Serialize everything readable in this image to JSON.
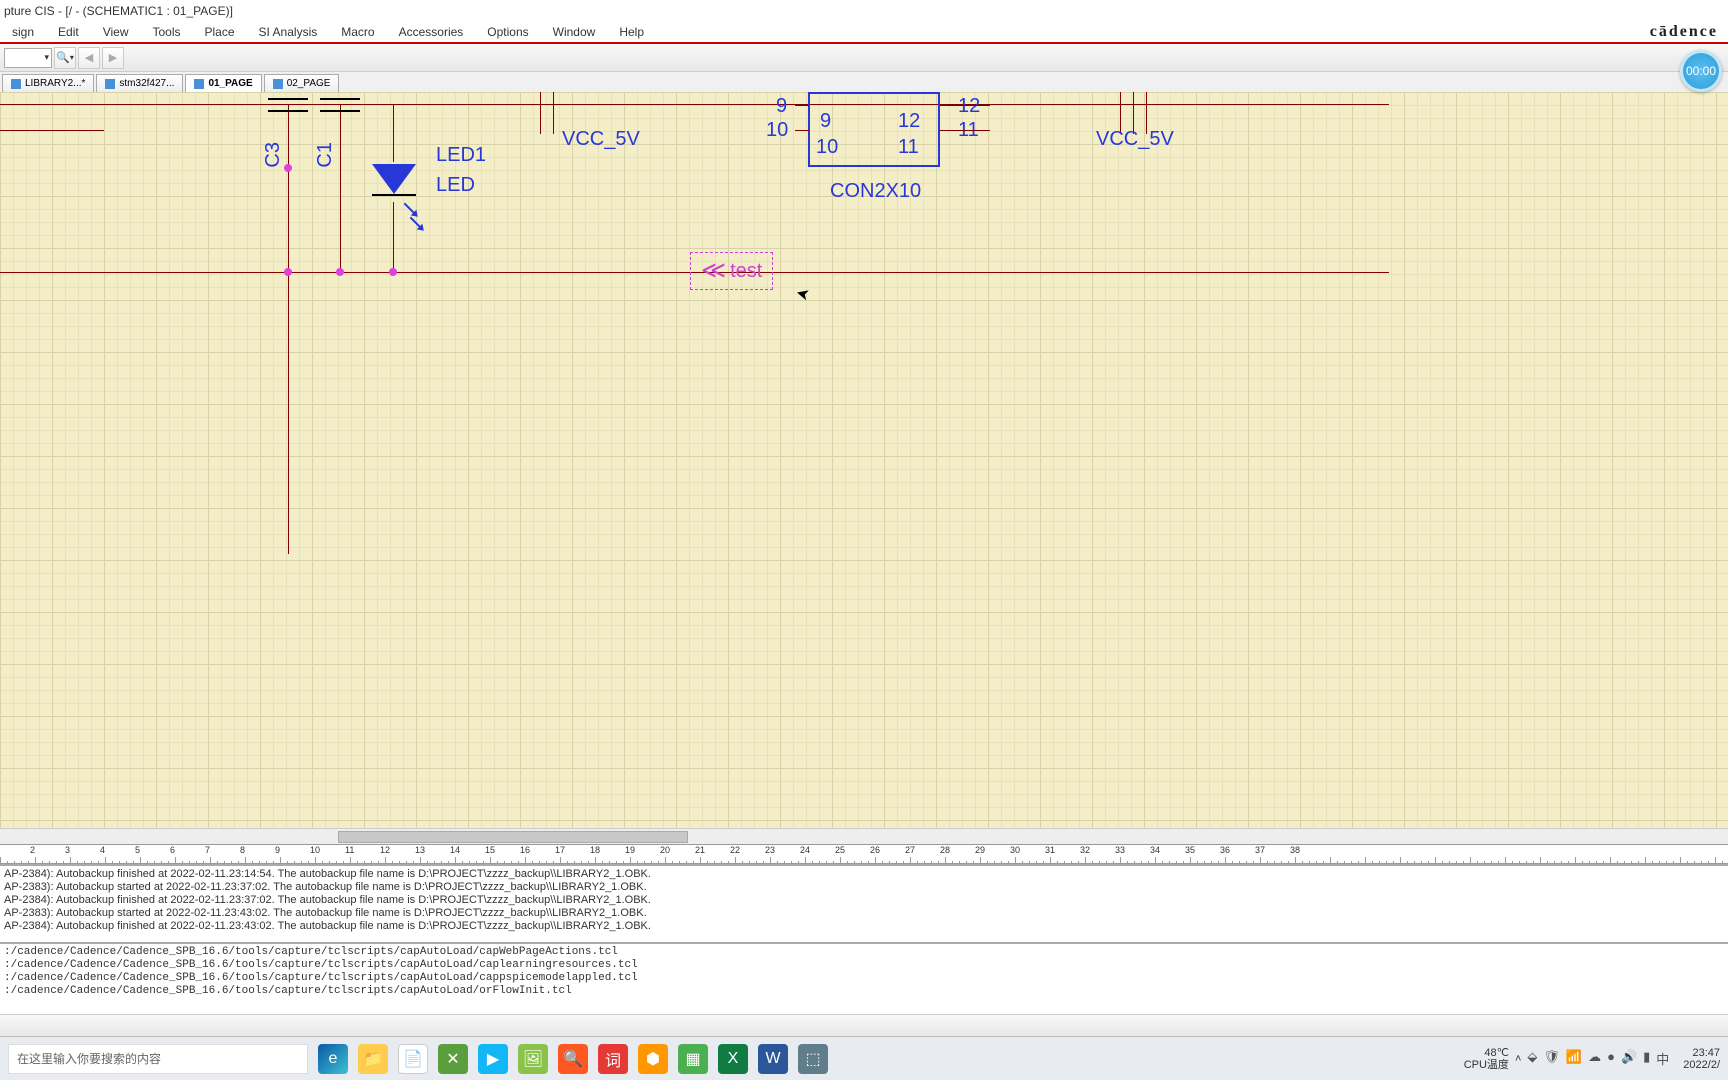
{
  "titlebar": "pture CIS - [/ - (SCHEMATIC1 : 01_PAGE)]",
  "menu": [
    "sign",
    "Edit",
    "View",
    "Tools",
    "Place",
    "SI Analysis",
    "Macro",
    "Accessories",
    "Options",
    "Window",
    "Help"
  ],
  "brand": "cādence",
  "timer": "00:00",
  "tabs": [
    {
      "label": "LIBRARY2...*",
      "active": false
    },
    {
      "label": "stm32f427...",
      "active": false
    },
    {
      "label": "01_PAGE",
      "active": true
    },
    {
      "label": "02_PAGE",
      "active": false
    }
  ],
  "schematic": {
    "refdes_c3": "C3",
    "refdes_c1": "C1",
    "led_ref": "LED1",
    "led_val": "LED",
    "vcc_left": "VCC_5V",
    "vcc_right": "VCC_5V",
    "conn_label": "CON2X10",
    "pins_left": [
      "9",
      "10"
    ],
    "pins_mid_l": [
      "9",
      "10"
    ],
    "pins_mid_r": [
      "12",
      "11"
    ],
    "pins_right": [
      "12",
      "11"
    ],
    "offpage": "test"
  },
  "ruler_numbers": [
    "2",
    "3",
    "4",
    "5",
    "6",
    "7",
    "8",
    "9",
    "10",
    "11",
    "12",
    "13",
    "14",
    "15",
    "16",
    "17",
    "18",
    "19",
    "20",
    "21",
    "22",
    "23",
    "24",
    "25",
    "26",
    "27",
    "28",
    "29",
    "30",
    "31",
    "32",
    "33",
    "34",
    "35",
    "36",
    "37",
    "38"
  ],
  "log": [
    "AP-2384): Autobackup finished at 2022-02-11.23:14:54. The autobackup file name is D:\\PROJECT\\zzzz_backup\\\\LIBRARY2_1.OBK.",
    "AP-2383): Autobackup started at 2022-02-11.23:37:02. The autobackup file name is D:\\PROJECT\\zzzz_backup\\\\LIBRARY2_1.OBK.",
    "AP-2384): Autobackup finished at 2022-02-11.23:37:02. The autobackup file name is D:\\PROJECT\\zzzz_backup\\\\LIBRARY2_1.OBK.",
    "AP-2383): Autobackup started at 2022-02-11.23:43:02. The autobackup file name is D:\\PROJECT\\zzzz_backup\\\\LIBRARY2_1.OBK.",
    "AP-2384): Autobackup finished at 2022-02-11.23:43:02. The autobackup file name is D:\\PROJECT\\zzzz_backup\\\\LIBRARY2_1.OBK."
  ],
  "tcl": [
    ":/cadence/Cadence/Cadence_SPB_16.6/tools/capture/tclscripts/capAutoLoad/capWebPageActions.tcl",
    ":/cadence/Cadence/Cadence_SPB_16.6/tools/capture/tclscripts/capAutoLoad/caplearningresources.tcl",
    ":/cadence/Cadence/Cadence_SPB_16.6/tools/capture/tclscripts/capAutoLoad/cappspicemodelappled.tcl",
    ":/cadence/Cadence/Cadence_SPB_16.6/tools/capture/tclscripts/capAutoLoad/orFlowInit.tcl"
  ],
  "taskbar": {
    "search_placeholder": "在这里输入你要搜索的内容",
    "temp": "48℃",
    "temp_label": "CPU温度",
    "time": "23:47",
    "date": "2022/2/"
  }
}
